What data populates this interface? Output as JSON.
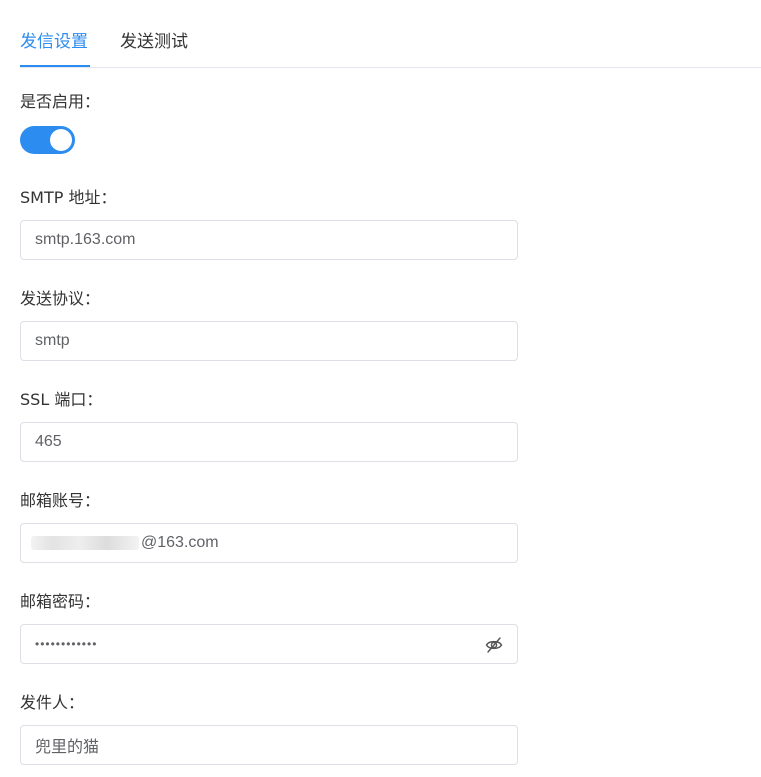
{
  "tabs": [
    {
      "label": "发信设置",
      "active": true
    },
    {
      "label": "发送测试",
      "active": false
    }
  ],
  "colors": {
    "accent": "#2d8cf0",
    "border": "#dcdfe6",
    "label": "#333333",
    "value": "#606266"
  },
  "form": {
    "enabled": {
      "label": "是否启用：",
      "value": true
    },
    "smtp_address": {
      "label": "SMTP 地址：",
      "value": "smtp.163.com"
    },
    "protocol": {
      "label": "发送协议：",
      "value": "smtp"
    },
    "ssl_port": {
      "label": "SSL 端口：",
      "value": "465"
    },
    "email_account": {
      "label": "邮箱账号：",
      "value": "@163.com"
    },
    "email_password": {
      "label": "邮箱密码：",
      "value": "••••••••••••",
      "toggle_icon": "eye-slash-icon"
    },
    "sender": {
      "label": "发件人：",
      "value": "兜里的猫"
    }
  }
}
